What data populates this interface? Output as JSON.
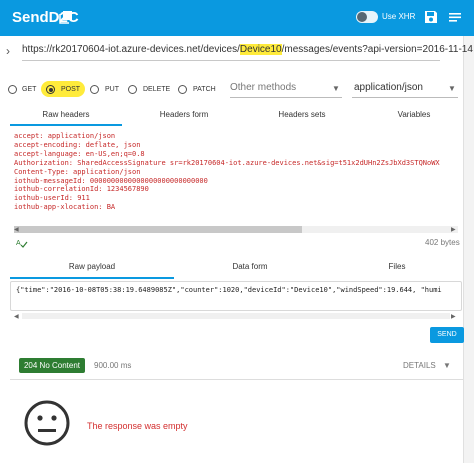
{
  "app": {
    "title": "SendD2C",
    "xhr_label": "Use XHR"
  },
  "request": {
    "url_prefix": "https://rk20170604-iot.azure-devices.net/devices/",
    "url_device": "Device10",
    "url_suffix": "/messages/events?api-version=2016-11-14",
    "methods": [
      "GET",
      "POST",
      "PUT",
      "DELETE",
      "PATCH"
    ],
    "selected_method": "POST",
    "other_methods_placeholder": "Other methods",
    "content_type": "application/json"
  },
  "header_tabs": [
    "Raw headers",
    "Headers form",
    "Headers sets",
    "Variables"
  ],
  "headers_raw": [
    "accept: application/json",
    "accept-encoding: deflate, json",
    "accept-language: en-US,en;q=0.8",
    "Authorization: SharedAccessSignature sr=rk20170604-iot.azure-devices.net&sig=t51x2dUHn2ZsJbXd3STQNoWX",
    "Content-Type: application/json",
    "iothub-messageId: 0000000000000000000000000000",
    "iothub-correlationId: 1234567890",
    "iothub-userId: 911",
    "iothub-app-xlocation: BA"
  ],
  "headers_size": "402 bytes",
  "payload_tabs": [
    "Raw payload",
    "Data form",
    "Files"
  ],
  "payload_raw": "{\"time\":\"2016-10-08T05:38:19.6489085Z\",\"counter\":1020,\"deviceId\":\"Device10\",\"windSpeed\":19.644, \"humi",
  "send_label": "SEND",
  "response": {
    "status": "204 No Content",
    "time": "900.00 ms",
    "details_label": "DETAILS",
    "empty_message": "The response was empty"
  },
  "colors": {
    "primary": "#0a99e0",
    "status_ok": "#2e7d32",
    "highlight": "#ffeb3b",
    "error_text": "#d32f2f"
  }
}
